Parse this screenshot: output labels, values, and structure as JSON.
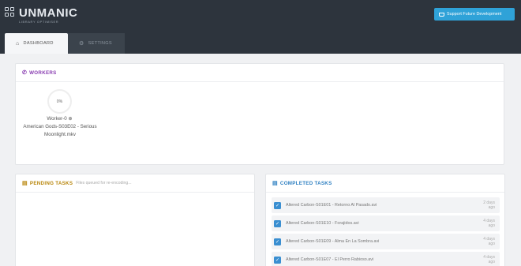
{
  "header": {
    "logo_name": "UNMANIC",
    "logo_sub": "LIBRARY OPTIMISER",
    "support_label": "Support Future Development"
  },
  "tabs": [
    {
      "label": "DASHBOARD",
      "icon": "home-icon"
    },
    {
      "label": "SETTINGS",
      "icon": "gear-icon"
    }
  ],
  "workers": {
    "title": "WORKERS",
    "items": [
      {
        "percent": "0%",
        "name": "Worker-0",
        "title": "American Gods-S03E02 - Serious Moonlight.mkv"
      }
    ]
  },
  "pending": {
    "title": "PENDING TASKS",
    "subtitle": "Files queued for re-encoding..."
  },
  "completed": {
    "title": "COMPLETED TASKS",
    "items": [
      {
        "name": "Altered Carbon-S01E01 - Retorno Al Pasado.avi",
        "age": "2 days ago"
      },
      {
        "name": "Altered Carbon-S01E10 - Forajidos.avi",
        "age": "4 days ago"
      },
      {
        "name": "Altered Carbon-S01E09 - Alma En La Sombra.avi",
        "age": "4 days ago"
      },
      {
        "name": "Altered Carbon-S01E07 - El Perro Rabioso.avi",
        "age": "4 days ago"
      }
    ]
  },
  "colors": {
    "topbar": "#2d343d",
    "accent_blue": "#2fa2d8",
    "workers_purple": "#8a3fb2",
    "pending_gold": "#b8860b",
    "completed_blue": "#2d7fc1"
  }
}
